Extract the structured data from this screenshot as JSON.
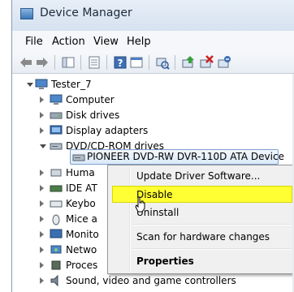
{
  "window": {
    "title": "Device Manager"
  },
  "menu": [
    "File",
    "Action",
    "View",
    "Help"
  ],
  "toolbar": {
    "icons": [
      "back-icon",
      "forward-icon",
      "show-hide-console-tree-icon",
      "properties-icon",
      "help-icon",
      "scan-hardware-icon",
      "update-driver-icon",
      "disable-device-icon",
      "uninstall-device-icon"
    ]
  },
  "tree": {
    "root": "Tester_7",
    "nodes": [
      "Computer",
      "Disk drives",
      "Display adapters",
      "DVD/CD-ROM drives",
      "PIONEER DVD-RW  DVR-110D ATA Device",
      "Huma",
      "IDE AT",
      "Keybo",
      "Mice a",
      "Monito",
      "Netwo",
      "Proces",
      "Sound, video and game controllers"
    ]
  },
  "context_menu": {
    "items": [
      "Update Driver Software...",
      "Disable",
      "Uninstall",
      "Scan for hardware changes",
      "Properties"
    ]
  },
  "colors": {
    "highlight": "#ffff33",
    "selection_border": "#7da2ce"
  }
}
